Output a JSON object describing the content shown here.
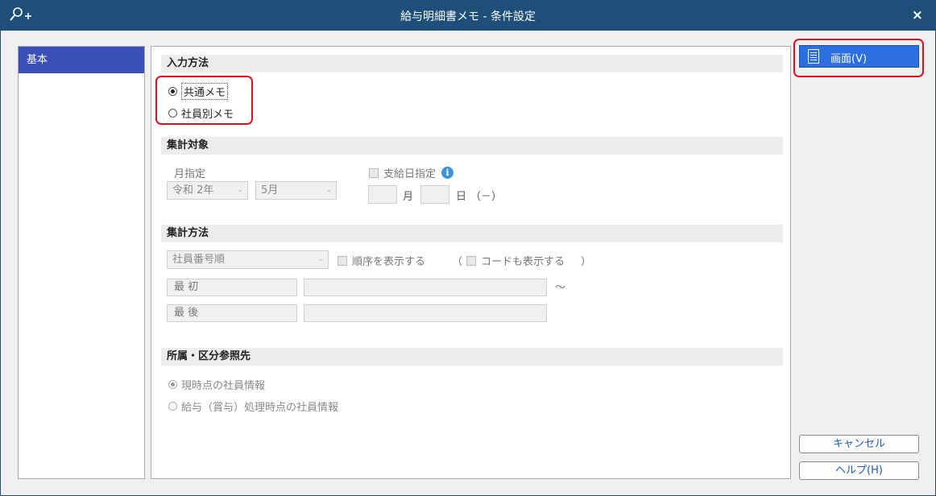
{
  "window": {
    "title": "給与明細書メモ - 条件設定",
    "close_label": "×"
  },
  "nav": {
    "items": [
      {
        "label": "基本",
        "selected": true
      }
    ]
  },
  "input_method": {
    "header": "入力方法",
    "options": [
      {
        "label": "共通メモ",
        "checked": true
      },
      {
        "label": "社員別メモ",
        "checked": false
      }
    ]
  },
  "aggregation_target": {
    "header": "集計対象",
    "month_label": "月指定",
    "era_year": "令和 2年",
    "month": "5月",
    "payday_label": "支給日指定",
    "payday_month_unit": "月",
    "payday_day_unit": "日",
    "payday_weekday": "（－）"
  },
  "aggregation_method": {
    "header": "集計方法",
    "order_select": "社員番号順",
    "show_order_label": "順序を表示する",
    "paren_open": "（",
    "show_code_label": "コードも表示する",
    "paren_close": "）",
    "first_label": "最 初",
    "last_label": "最 後",
    "range_sep": "～"
  },
  "dept_reference": {
    "header": "所属・区分参照先",
    "options": [
      {
        "label": "現時点の社員情報",
        "checked": true
      },
      {
        "label": "給与（賞与）処理時点の社員情報",
        "checked": false
      }
    ]
  },
  "buttons": {
    "view": "画面(V)",
    "cancel": "キャンセル",
    "help": "ヘルプ(H)"
  },
  "colors": {
    "titlebar": "#1e4f7a",
    "nav_selected": "#3b4fb8",
    "primary_button": "#2c6fe0",
    "highlight": "#e0101e",
    "info_icon": "#3a92d8"
  }
}
